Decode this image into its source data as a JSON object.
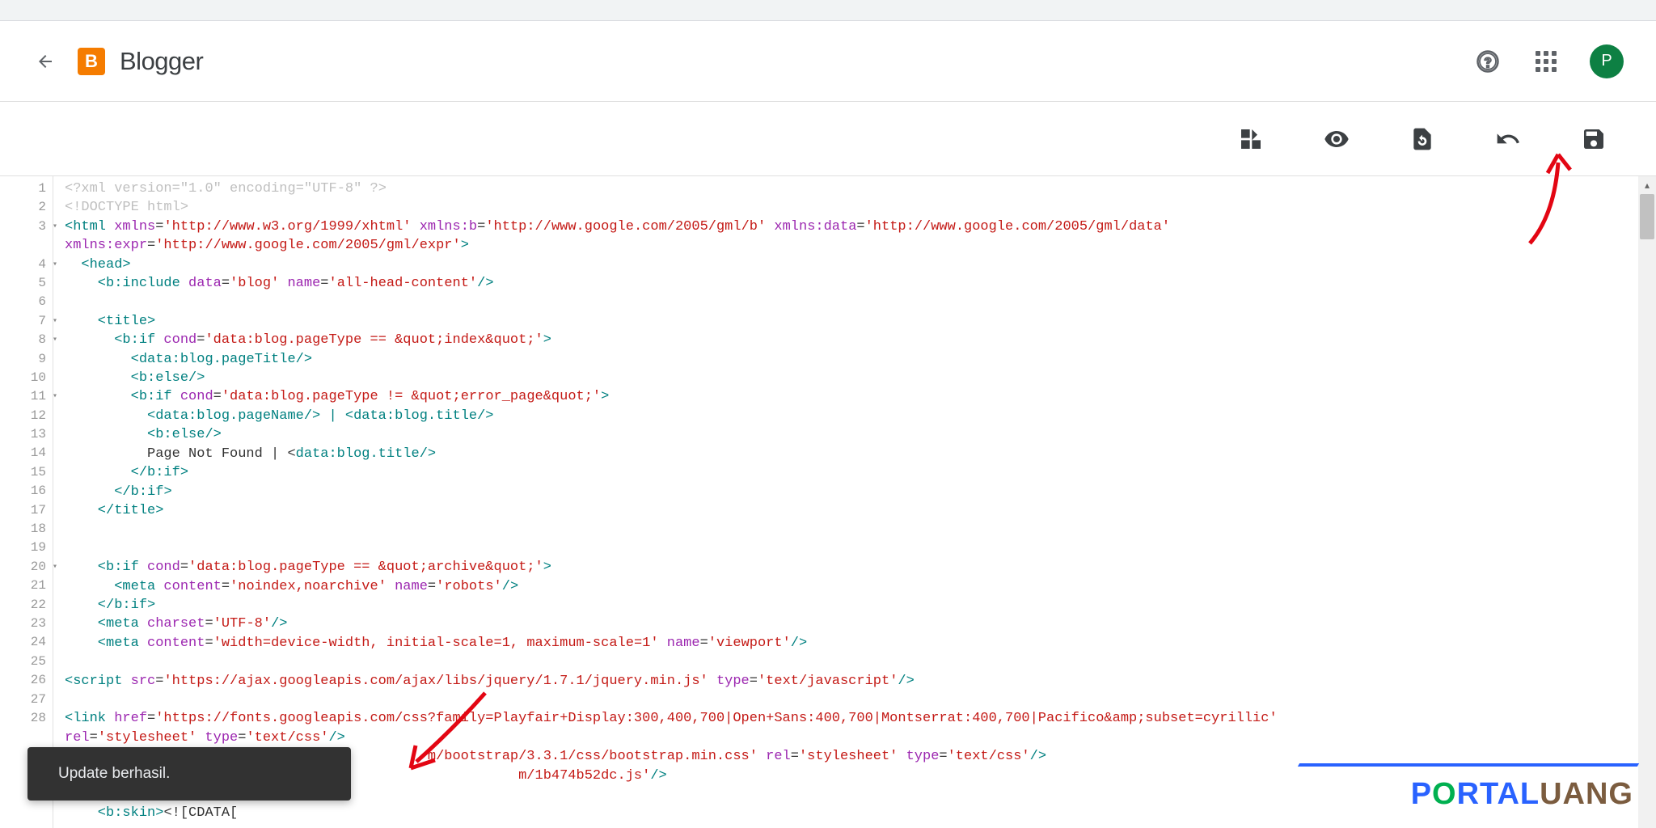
{
  "header": {
    "app_title": "Blogger",
    "logo_letter": "B",
    "avatar_letter": "P"
  },
  "toast": {
    "message": "Update berhasil."
  },
  "editor": {
    "gutter": [
      {
        "n": 1,
        "fold": false
      },
      {
        "n": 2,
        "fold": false
      },
      {
        "n": 3,
        "fold": true
      },
      {
        "n": "",
        "fold": false
      },
      {
        "n": 4,
        "fold": true
      },
      {
        "n": 5,
        "fold": false
      },
      {
        "n": 6,
        "fold": false
      },
      {
        "n": 7,
        "fold": true
      },
      {
        "n": 8,
        "fold": true
      },
      {
        "n": 9,
        "fold": false
      },
      {
        "n": 10,
        "fold": false
      },
      {
        "n": 11,
        "fold": true
      },
      {
        "n": 12,
        "fold": false
      },
      {
        "n": 13,
        "fold": false
      },
      {
        "n": 14,
        "fold": false
      },
      {
        "n": 15,
        "fold": false
      },
      {
        "n": 16,
        "fold": false
      },
      {
        "n": 17,
        "fold": false
      },
      {
        "n": 18,
        "fold": false
      },
      {
        "n": 19,
        "fold": false
      },
      {
        "n": 20,
        "fold": true
      },
      {
        "n": 21,
        "fold": false
      },
      {
        "n": 22,
        "fold": false
      },
      {
        "n": 23,
        "fold": false
      },
      {
        "n": 24,
        "fold": false
      },
      {
        "n": 25,
        "fold": false
      },
      {
        "n": 26,
        "fold": false
      },
      {
        "n": 27,
        "fold": false
      },
      {
        "n": 28,
        "fold": false
      },
      {
        "n": "",
        "fold": false
      },
      {
        "n": "",
        "fold": false
      },
      {
        "n": "",
        "fold": false
      },
      {
        "n": 32,
        "fold": false
      }
    ],
    "lines": {
      "l1_a": "<?xml ",
      "l1_b": "version",
      "l1_c": "=",
      "l1_d": "\"1.0\"",
      "l1_e": " encoding",
      "l1_f": "=",
      "l1_g": "\"UTF-8\"",
      "l1_h": " ?>",
      "l2": "<!DOCTYPE html>",
      "l3_a": "<",
      "l3_b": "html",
      "l3_c": " xmlns",
      "l3_d": "=",
      "l3_e": "'http://www.w3.org/1999/xhtml'",
      "l3_f": " xmlns:b",
      "l3_g": "=",
      "l3_h": "'http://www.google.com/2005/gml/b'",
      "l3_i": " xmlns:data",
      "l3_j": "=",
      "l3_k": "'http://www.google.com/2005/gml/data'",
      "l3x_a": "xmlns:expr",
      "l3x_b": "=",
      "l3x_c": "'http://www.google.com/2005/gml/expr'",
      "l3x_d": ">",
      "l4_a": "  <",
      "l4_b": "head",
      "l4_c": ">",
      "l5_a": "    <",
      "l5_b": "b:include",
      "l5_c": " data",
      "l5_d": "=",
      "l5_e": "'blog'",
      "l5_f": " name",
      "l5_g": "=",
      "l5_h": "'all-head-content'",
      "l5_i": "/>",
      "l7_a": "    <",
      "l7_b": "title",
      "l7_c": ">",
      "l8_a": "      <",
      "l8_b": "b:if",
      "l8_c": " cond",
      "l8_d": "=",
      "l8_e": "'data:blog.pageType == &quot;index&quot;'",
      "l8_f": ">",
      "l9_a": "        <",
      "l9_b": "data:blog.pageTitle",
      "l9_c": "/>",
      "l10_a": "        <",
      "l10_b": "b:else",
      "l10_c": "/>",
      "l11_a": "        <",
      "l11_b": "b:if",
      "l11_c": " cond",
      "l11_d": "=",
      "l11_e": "'data:blog.pageType != &quot;error_page&quot;'",
      "l11_f": ">",
      "l12_a": "          <",
      "l12_b": "data:blog.pageName",
      "l12_c": "/> | <",
      "l12_d": "data:blog.title",
      "l12_e": "/>",
      "l13_a": "          <",
      "l13_b": "b:else",
      "l13_c": "/>",
      "l14_a": "          Page Not Found | <",
      "l14_b": "data:blog.title",
      "l14_c": "/>",
      "l15_a": "        </",
      "l15_b": "b:if",
      "l15_c": ">",
      "l16_a": "      </",
      "l16_b": "b:if",
      "l16_c": ">",
      "l17_a": "    </",
      "l17_b": "title",
      "l17_c": ">",
      "l20_a": "    <",
      "l20_b": "b:if",
      "l20_c": " cond",
      "l20_d": "=",
      "l20_e": "'data:blog.pageType == &quot;archive&quot;'",
      "l20_f": ">",
      "l21_a": "      <",
      "l21_b": "meta",
      "l21_c": " content",
      "l21_d": "=",
      "l21_e": "'noindex,noarchive'",
      "l21_f": " name",
      "l21_g": "=",
      "l21_h": "'robots'",
      "l21_i": "/>",
      "l22_a": "    </",
      "l22_b": "b:if",
      "l22_c": ">",
      "l23_a": "    <",
      "l23_b": "meta",
      "l23_c": " charset",
      "l23_d": "=",
      "l23_e": "'UTF-8'",
      "l23_f": "/>",
      "l24_a": "    <",
      "l24_b": "meta",
      "l24_c": " content",
      "l24_d": "=",
      "l24_e": "'width=device-width, initial-scale=1, maximum-scale=1'",
      "l24_f": " name",
      "l24_g": "=",
      "l24_h": "'viewport'",
      "l24_i": "/>",
      "l26_a": "<",
      "l26_b": "script",
      "l26_c": " src",
      "l26_d": "=",
      "l26_e": "'https://ajax.googleapis.com/ajax/libs/jquery/1.7.1/jquery.min.js'",
      "l26_f": " type",
      "l26_g": "=",
      "l26_h": "'text/javascript'",
      "l26_i": "/>",
      "l28_a": "<",
      "l28_b": "link",
      "l28_c": " href",
      "l28_d": "=",
      "l28_e": "'https://fonts.googleapis.com/css?family=Playfair+Display:300,400,700|Open+Sans:400,700|Montserrat:400,700|Pacifico&amp;subset=cyrillic'",
      "l28x_a": "rel",
      "l28x_b": "=",
      "l28x_c": "'stylesheet'",
      "l28x_d": " type",
      "l28x_e": "=",
      "l28x_f": "'text/css'",
      "l28x_g": "/>",
      "l29_a": "m/bootstrap/3.3.1/css/bootstrap.min.css'",
      "l29_b": " rel",
      "l29_c": "=",
      "l29_d": "'stylesheet'",
      "l29_e": " type",
      "l29_f": "=",
      "l29_g": "'text/css'",
      "l29_h": "/>",
      "l30_a": "m/1b474b52dc.js'",
      "l30_b": "/>",
      "l32_a": "    <",
      "l32_b": "b:skin",
      "l32_c": ">",
      "l32_d": "<![CDATA["
    }
  },
  "watermark": {
    "text": "PORTALUANG"
  }
}
